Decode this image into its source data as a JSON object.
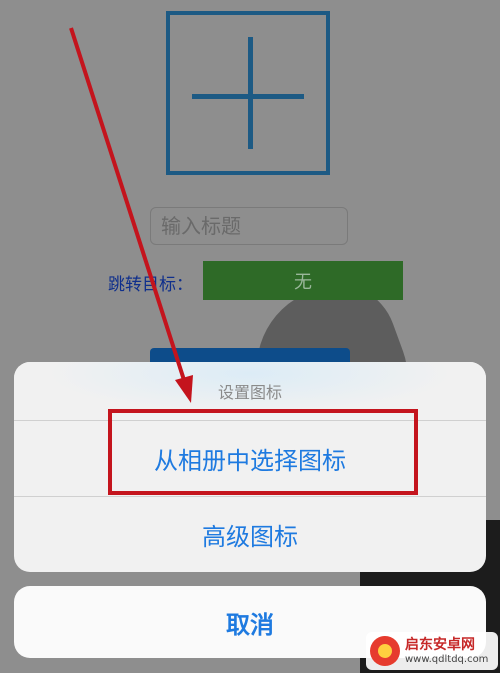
{
  "app": {
    "add_icon": "plus-icon",
    "title_input": {
      "placeholder": "输入标题",
      "value": ""
    },
    "jump_label": "跳转目标：",
    "jump_select": {
      "value": "无"
    }
  },
  "action_sheet": {
    "title": "设置图标",
    "options": [
      {
        "label": "从相册中选择图标",
        "highlighted": true
      },
      {
        "label": "高级图标",
        "highlighted": false
      }
    ],
    "cancel_label": "取消"
  },
  "annotation": {
    "highlight_color": "#c4141d",
    "arrow_color": "#c4141d"
  },
  "watermark": {
    "name": "启东安卓网",
    "url": "www.qdltdq.com"
  },
  "colors": {
    "ios_blue": "#1e7ae0",
    "select_green": "#2e6a27",
    "icon_blue": "#1d5a84"
  }
}
